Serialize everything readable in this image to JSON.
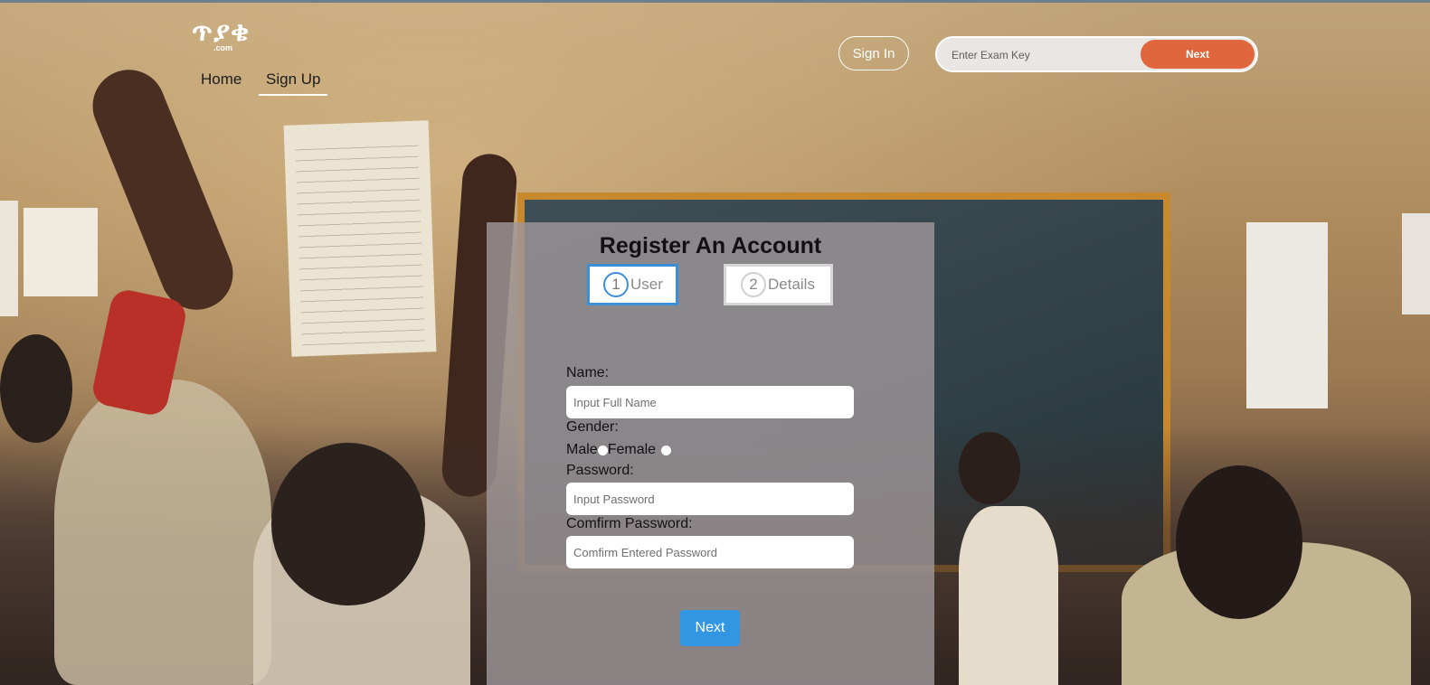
{
  "brand": {
    "logo_text": "ጥያቄ",
    "logo_suffix": ".com"
  },
  "nav": {
    "items": [
      {
        "label": "Home"
      },
      {
        "label": "Sign Up",
        "active": true
      }
    ]
  },
  "header": {
    "signin_label": "Sign In",
    "exam_key_placeholder": "Enter Exam Key",
    "exam_next_label": "Next"
  },
  "form": {
    "title": "Register An Account",
    "steps": [
      {
        "number": "1",
        "label": "User",
        "active": true
      },
      {
        "number": "2",
        "label": "Details",
        "active": false
      }
    ],
    "name_label": "Name:",
    "name_placeholder": "Input Full Name",
    "gender_label": "Gender:",
    "gender_options": [
      "Male",
      "Female"
    ],
    "password_label": "Password:",
    "password_placeholder": "Input Password",
    "confirm_label": "Comfirm Password:",
    "confirm_placeholder": "Comfirm Entered Password",
    "next_label": "Next"
  },
  "colors": {
    "accent_orange": "#e0663e",
    "accent_blue": "#3396e2",
    "step_active_border": "#3a8fd8"
  }
}
